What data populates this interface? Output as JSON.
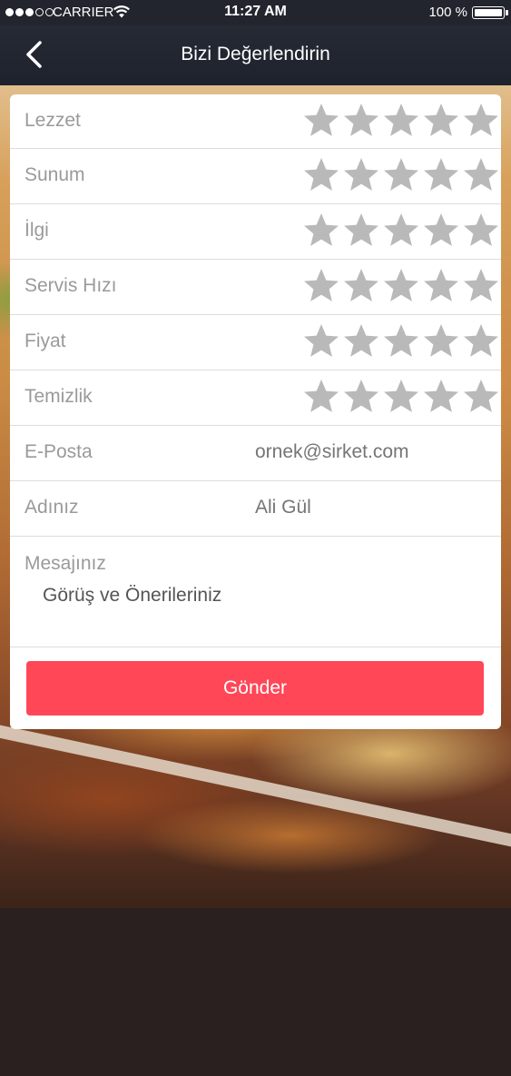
{
  "status_bar": {
    "carrier": "CARRIER",
    "time": "11:27 AM",
    "battery": "100 %",
    "signal_bars_filled": 3,
    "signal_bars_total": 5
  },
  "navbar": {
    "title": "Bizi Değerlendirin",
    "back_icon": "chevron-left-icon"
  },
  "ratings": [
    {
      "label": "Lezzet",
      "stars": 0,
      "max": 5
    },
    {
      "label": "Sunum",
      "stars": 0,
      "max": 5
    },
    {
      "label": "İlgi",
      "stars": 0,
      "max": 5
    },
    {
      "label": "Servis Hızı",
      "stars": 0,
      "max": 5
    },
    {
      "label": "Fiyat",
      "stars": 0,
      "max": 5
    },
    {
      "label": "Temizlik",
      "stars": 0,
      "max": 5
    }
  ],
  "form": {
    "email_label": "E-Posta",
    "email_placeholder": "ornek@sirket.com",
    "name_label": "Adınız",
    "name_placeholder": "Ali Gül",
    "message_label": "Mesajınız",
    "message_placeholder": "Görüş ve Önerileriniz",
    "submit_label": "Gönder"
  },
  "colors": {
    "navbar": "#22252e",
    "submit_button": "#ff4757",
    "star_empty": "#b9b9b9",
    "label_text": "#9a9a9a"
  }
}
